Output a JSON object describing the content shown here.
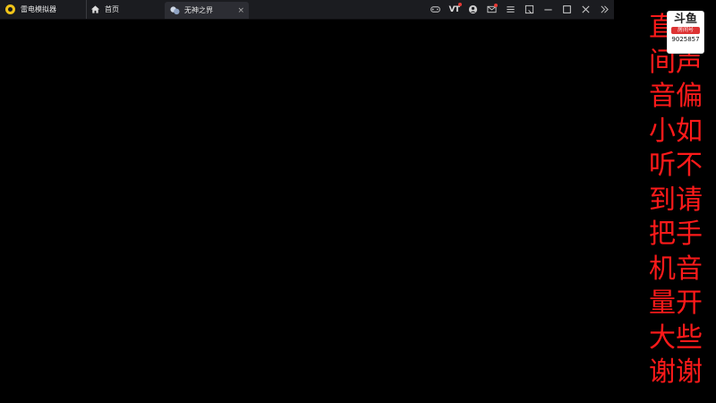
{
  "window": {
    "app_tab_label": "雷电模拟器",
    "home_tab_label": "首页",
    "game_tab_label": "无神之界",
    "game_tab_close": "×"
  },
  "toolbar": {
    "items": [
      "gamepad-icon",
      "vt-icon",
      "user-icon",
      "mail-icon",
      "menu-icon",
      "minimize-to-window-icon",
      "minimize-icon",
      "maximize-icon",
      "close-icon",
      "expand-sidebar-icon"
    ],
    "vt_label": "VT"
  },
  "overlay": {
    "text": "直播间声音偏小如听不到请把手机音量开大些谢谢",
    "color": "#ff1a1a"
  },
  "badge": {
    "logo": "斗鱼",
    "subtitle": "房间号",
    "room_id": "9025857"
  },
  "colors": {
    "titlebar_bg": "#1b1c20",
    "active_tab_bg": "#2c2d33",
    "screen_bg": "#000000"
  }
}
